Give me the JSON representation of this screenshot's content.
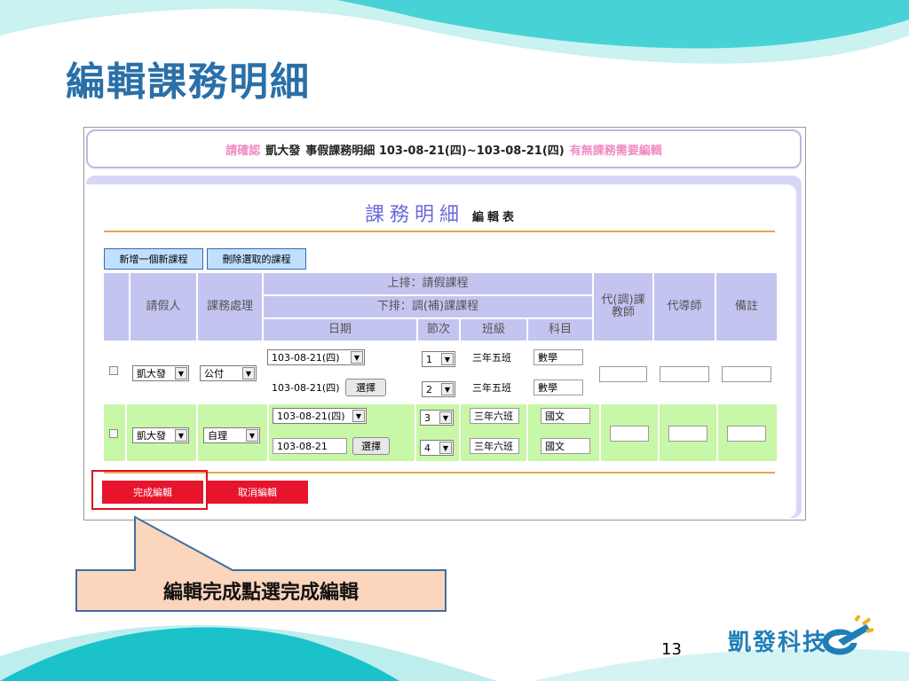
{
  "slide": {
    "title": "編輯課務明細",
    "page_number": "13",
    "brand_name": "凱發科技"
  },
  "banner": {
    "prefix": "請確認",
    "person": "凱大發",
    "middle": "事假課務明細 103-08-21(四)~103-08-21(四)",
    "suffix": "有無課務需要編輯"
  },
  "panel": {
    "title_big": "課務明細",
    "title_small": "編輯表"
  },
  "toolbar": {
    "add_label": "新增一個新課程",
    "delete_label": "刪除選取的課程"
  },
  "table": {
    "headers": {
      "requester": "請假人",
      "handling": "課務處理",
      "upper": "上排：請假課程",
      "lower": "下排：調(補)課課程",
      "date": "日期",
      "period": "節次",
      "class": "班級",
      "subject": "科目",
      "substitute": "代(調)課教師",
      "sub_mentor": "代導師",
      "notes": "備註"
    },
    "rows": [
      {
        "requester": "凱大發",
        "handling": "公付",
        "upper": {
          "date": "103-08-21(四)",
          "period": "1",
          "class": "三年五班",
          "subject": "數學"
        },
        "lower": {
          "date": "103-08-21(四)",
          "pick": "選擇",
          "period": "2",
          "class": "三年五班",
          "subject": "數學"
        }
      },
      {
        "requester": "凱大發",
        "handling": "自理",
        "upper": {
          "date": "103-08-21(四)",
          "period": "3",
          "class": "三年六班",
          "subject": "國文"
        },
        "lower": {
          "date": "103-08-21",
          "pick": "選擇",
          "period": "4",
          "class": "三年六班",
          "subject": "國文"
        }
      }
    ]
  },
  "actions": {
    "finish_label": "完成編輯",
    "cancel_label": "取消編輯"
  },
  "callout": {
    "text": "編輯完成點選完成編輯"
  },
  "colors": {
    "title_blue": "#2a6fa8",
    "accent_pink": "#f08ac0",
    "header_lavender": "#c4c4f0",
    "row_green": "#c8f7a8",
    "button_red": "#e8142c",
    "callout_peach": "#fbd5bc"
  }
}
